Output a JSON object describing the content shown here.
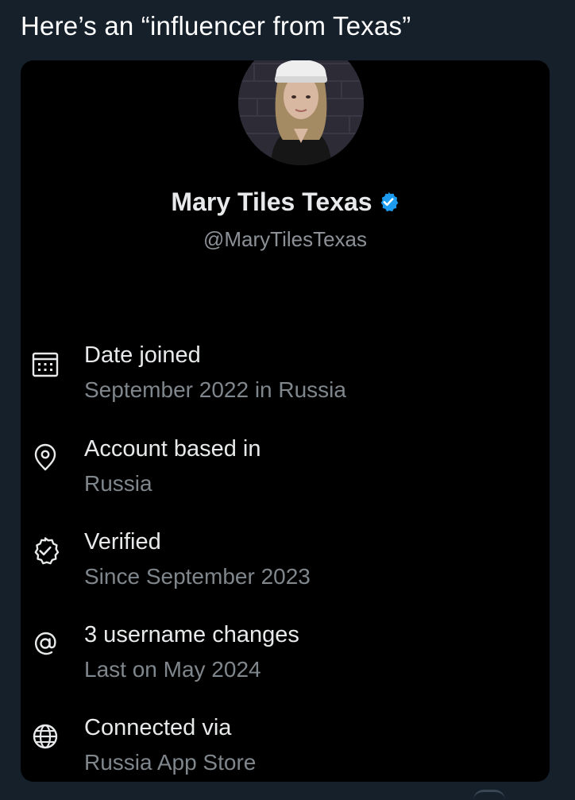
{
  "post": {
    "caption": "Here’s an “influencer from Texas”"
  },
  "profile": {
    "display_name": "Mary Tiles Texas",
    "handle": "@MaryTilesTexas",
    "verified": true
  },
  "about": {
    "items": [
      {
        "icon": "calendar-icon",
        "title": "Date joined",
        "subtitle": "September 2022 in Russia"
      },
      {
        "icon": "location-pin-icon",
        "title": "Account based in",
        "subtitle": "Russia"
      },
      {
        "icon": "verified-badge-icon",
        "title": "Verified",
        "subtitle": "Since September 2023"
      },
      {
        "icon": "at-sign-icon",
        "title": "3 username changes",
        "subtitle": "Last on May 2024"
      },
      {
        "icon": "globe-icon",
        "title": "Connected via",
        "subtitle": "Russia App Store"
      }
    ]
  },
  "colors": {
    "page_background": "#15202b",
    "card_background": "#000000",
    "verified_blue": "#1d9bf0",
    "primary_text": "#e7e9ea",
    "secondary_text": "#7f868c"
  }
}
